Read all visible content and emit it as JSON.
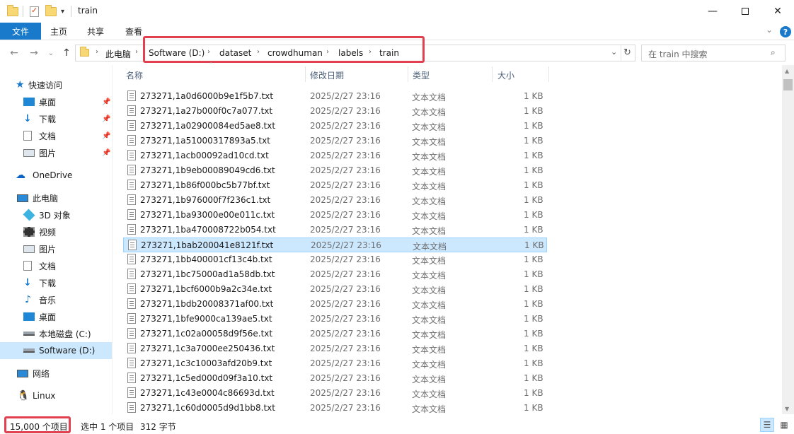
{
  "window": {
    "title": "train"
  },
  "ribbon": {
    "tabs": [
      "文件",
      "主页",
      "共享",
      "查看"
    ]
  },
  "address": {
    "segments": [
      "此电脑",
      "Software (D:)",
      "dataset",
      "crowdhuman",
      "labels",
      "train"
    ]
  },
  "search": {
    "placeholder": "在 train 中搜索"
  },
  "sidebar": {
    "items": [
      {
        "label": "快速访问",
        "icon": "star-icon"
      },
      {
        "label": "桌面",
        "icon": "desktop-icon",
        "pinned": true
      },
      {
        "label": "下载",
        "icon": "download-icon",
        "pinned": true
      },
      {
        "label": "文档",
        "icon": "document-icon",
        "pinned": true
      },
      {
        "label": "图片",
        "icon": "picture-icon",
        "pinned": true
      },
      {
        "label": "OneDrive",
        "icon": "cloud-icon"
      },
      {
        "label": "此电脑",
        "icon": "computer-icon"
      },
      {
        "label": "3D 对象",
        "icon": "cube-icon"
      },
      {
        "label": "视频",
        "icon": "video-icon"
      },
      {
        "label": "图片",
        "icon": "picture-icon"
      },
      {
        "label": "文档",
        "icon": "document-icon"
      },
      {
        "label": "下载",
        "icon": "download-icon"
      },
      {
        "label": "音乐",
        "icon": "music-icon"
      },
      {
        "label": "桌面",
        "icon": "desktop-icon"
      },
      {
        "label": "本地磁盘 (C:)",
        "icon": "drive-icon"
      },
      {
        "label": "Software (D:)",
        "icon": "drive-icon",
        "active": true
      },
      {
        "label": "网络",
        "icon": "network-icon"
      },
      {
        "label": "Linux",
        "icon": "linux-icon"
      }
    ]
  },
  "columns": [
    "名称",
    "修改日期",
    "类型",
    "大小"
  ],
  "files": [
    {
      "name": "273271,1a0d6000b9e1f5b7.txt",
      "date": "2025/2/27 23:16",
      "type": "文本文档",
      "size": "1 KB"
    },
    {
      "name": "273271,1a27b000f0c7a077.txt",
      "date": "2025/2/27 23:16",
      "type": "文本文档",
      "size": "1 KB"
    },
    {
      "name": "273271,1a02900084ed5ae8.txt",
      "date": "2025/2/27 23:16",
      "type": "文本文档",
      "size": "1 KB"
    },
    {
      "name": "273271,1a51000317893a5.txt",
      "date": "2025/2/27 23:16",
      "type": "文本文档",
      "size": "1 KB"
    },
    {
      "name": "273271,1acb00092ad10cd.txt",
      "date": "2025/2/27 23:16",
      "type": "文本文档",
      "size": "1 KB"
    },
    {
      "name": "273271,1b9eb00089049cd6.txt",
      "date": "2025/2/27 23:16",
      "type": "文本文档",
      "size": "1 KB"
    },
    {
      "name": "273271,1b86f000bc5b77bf.txt",
      "date": "2025/2/27 23:16",
      "type": "文本文档",
      "size": "1 KB"
    },
    {
      "name": "273271,1b976000f7f236c1.txt",
      "date": "2025/2/27 23:16",
      "type": "文本文档",
      "size": "1 KB"
    },
    {
      "name": "273271,1ba93000e00e011c.txt",
      "date": "2025/2/27 23:16",
      "type": "文本文档",
      "size": "1 KB"
    },
    {
      "name": "273271,1ba470008722b054.txt",
      "date": "2025/2/27 23:16",
      "type": "文本文档",
      "size": "1 KB"
    },
    {
      "name": "273271,1bab200041e8121f.txt",
      "date": "2025/2/27 23:16",
      "type": "文本文档",
      "size": "1 KB",
      "selected": true
    },
    {
      "name": "273271,1bb400001cf13c4b.txt",
      "date": "2025/2/27 23:16",
      "type": "文本文档",
      "size": "1 KB"
    },
    {
      "name": "273271,1bc75000ad1a58db.txt",
      "date": "2025/2/27 23:16",
      "type": "文本文档",
      "size": "1 KB"
    },
    {
      "name": "273271,1bcf6000b9a2c34e.txt",
      "date": "2025/2/27 23:16",
      "type": "文本文档",
      "size": "1 KB"
    },
    {
      "name": "273271,1bdb20008371af00.txt",
      "date": "2025/2/27 23:16",
      "type": "文本文档",
      "size": "1 KB"
    },
    {
      "name": "273271,1bfe9000ca139ae5.txt",
      "date": "2025/2/27 23:16",
      "type": "文本文档",
      "size": "1 KB"
    },
    {
      "name": "273271,1c02a00058d9f56e.txt",
      "date": "2025/2/27 23:16",
      "type": "文本文档",
      "size": "1 KB"
    },
    {
      "name": "273271,1c3a7000ee250436.txt",
      "date": "2025/2/27 23:16",
      "type": "文本文档",
      "size": "1 KB"
    },
    {
      "name": "273271,1c3c10003afd20b9.txt",
      "date": "2025/2/27 23:16",
      "type": "文本文档",
      "size": "1 KB"
    },
    {
      "name": "273271,1c5ed000d09f3a10.txt",
      "date": "2025/2/27 23:16",
      "type": "文本文档",
      "size": "1 KB"
    },
    {
      "name": "273271,1c43e0004c86693d.txt",
      "date": "2025/2/27 23:16",
      "type": "文本文档",
      "size": "1 KB"
    },
    {
      "name": "273271,1c60d0005d9d1bb8.txt",
      "date": "2025/2/27 23:16",
      "type": "文本文档",
      "size": "1 KB"
    }
  ],
  "status": {
    "count": "15,000 个项目",
    "selection": "选中 1 个项目",
    "size": "312 字节"
  },
  "colors": {
    "accent": "#1979ca",
    "highlight_box": "#e0404f",
    "selection": "#cce8ff"
  }
}
